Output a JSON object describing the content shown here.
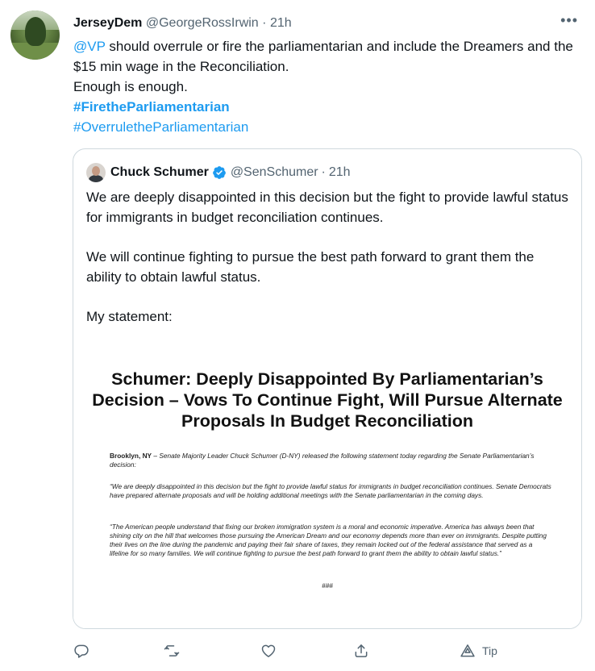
{
  "tweet": {
    "author": {
      "display_name": "JerseyDem",
      "handle": "@GeorgeRossIrwin",
      "dot": "·",
      "time": "21h"
    },
    "more_label": "•••",
    "text": {
      "mention": "@VP",
      "line1_rest": " should overrule or fire the parliamentarian and include the Dreamers and the $15 min wage in the Reconciliation.",
      "line2": "Enough is enough.",
      "hashtag1": "#FiretheParliamentarian",
      "hashtag2": "#OverruletheParliamentarian"
    }
  },
  "quote": {
    "author": {
      "display_name": "Chuck Schumer",
      "handle": "@SenSchumer",
      "dot": "·",
      "time": "21h"
    },
    "paragraphs": [
      "We are deeply disappointed in this decision but the fight to provide lawful status for immigrants in budget reconciliation continues.",
      "We will continue fighting to pursue the best path forward to grant them the ability to obtain lawful status.",
      "My statement:"
    ],
    "statement_image": {
      "title": "Schumer: Deeply Disappointed By Parliamentarian’s Decision – Vows To Continue Fight, Will Pursue Alternate Proposals In Budget Reconciliation",
      "place": "Brooklyn, NY",
      "p1_rest": " – Senate Majority Leader Chuck Schumer (D-NY) released the following statement today regarding the Senate Parliamentarian’s decision:",
      "p2": "“We are deeply disappointed in this decision but the fight to provide lawful status for immigrants in budget reconciliation continues. Senate Democrats have prepared alternate proposals and will be holding additional meetings with the Senate parliamentarian in the coming days.",
      "p3": "“The American people understand that fixing our broken immigration system is a moral and economic imperative. America has always been that shining city on the hill that welcomes those pursuing the American Dream and our economy depends more than ever on immigrants. Despite putting their lives on the line during the pandemic and paying their fair share of taxes, they remain locked out of the federal assistance that served as a lifeline for so many families. We will continue fighting to pursue the best path forward to grant them the ability to obtain lawful status.”",
      "end_mark": "###"
    }
  },
  "actions": {
    "tip_label": "Tip",
    "icons": [
      "reply-icon",
      "retweet-icon",
      "like-icon",
      "share-icon",
      "tip-icon"
    ]
  },
  "colors": {
    "link": "#1d9bf0",
    "secondary_text": "#536471",
    "border": "#cfd9de",
    "verified": "#1d9bf0"
  }
}
